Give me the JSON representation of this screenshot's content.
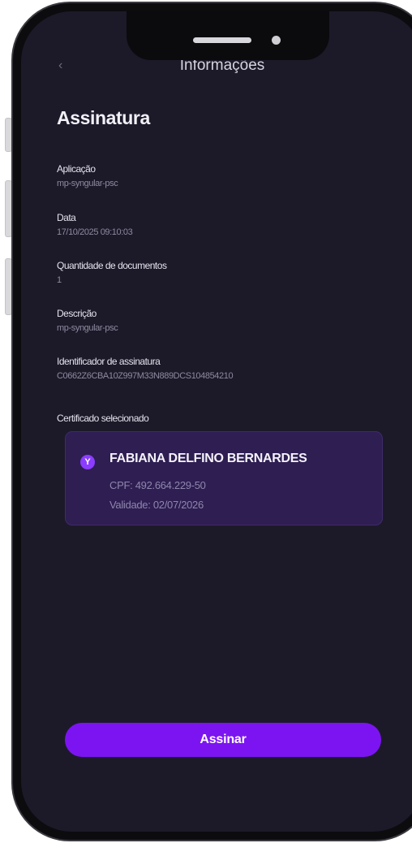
{
  "header": {
    "title": "Informações",
    "back_icon": "back-arrow-icon"
  },
  "page": {
    "title": "Assinatura"
  },
  "fields": [
    {
      "label": "Aplicação",
      "value": "mp-syngular-psc"
    },
    {
      "label": "Data",
      "value": "17/10/2025 09:10:03"
    },
    {
      "label": "Quantidade de documentos",
      "value": "1"
    },
    {
      "label": "Descrição",
      "value": "mp-syngular-psc"
    },
    {
      "label": "Identificador de assinatura",
      "value": "C0662Z6CBA10Z997M33N889DCS104854210"
    }
  ],
  "certificate": {
    "heading": "Certificado selecionado",
    "avatar_letter": "Y",
    "name": "FABIANA DELFINO BERNARDES",
    "cpf": "CPF: 492.664.229-50",
    "validity": "Validade: 02/07/2026"
  },
  "actions": {
    "sign_label": "Assinar"
  },
  "colors": {
    "screen_bg": "#1c1a29",
    "accent": "#7c14f2",
    "card_bg": "#2e1e52"
  }
}
